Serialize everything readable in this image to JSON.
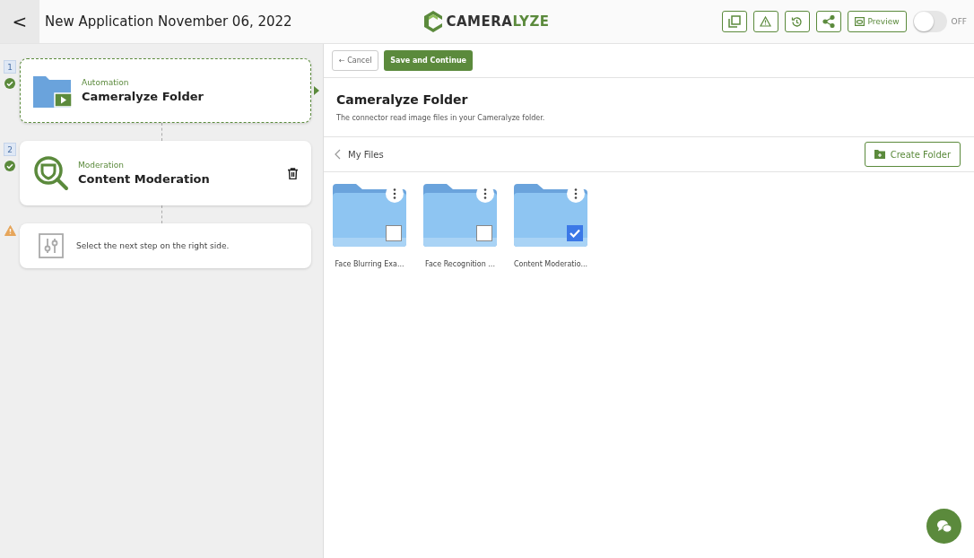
{
  "header": {
    "back": "<",
    "title": "New Application November 06, 2022",
    "logo_text": [
      "CAMERA",
      "LYZE"
    ],
    "tools": [
      {
        "kind": "copy"
      },
      {
        "kind": "warning"
      },
      {
        "kind": "history"
      },
      {
        "kind": "share"
      }
    ],
    "preview": "Preview",
    "toggle": {
      "on": false,
      "label": "OFF"
    }
  },
  "steps": [
    {
      "number": "1",
      "complete": true,
      "kind": "folder",
      "category": "Automation",
      "title": "Cameralyze Folder",
      "selected": true,
      "deletable": false
    },
    {
      "number": "2",
      "complete": true,
      "kind": "moderation",
      "category": "Moderation",
      "title": "Content Moderation",
      "selected": false,
      "deletable": true
    },
    {
      "complete": false,
      "kind": "placeholder",
      "text": "Select the next step on the right side.",
      "selected": false,
      "deletable": false
    }
  ],
  "panel": {
    "cancel": "← Cancel",
    "save": "Save and Continue",
    "title": "Cameralyze Folder",
    "description": "The connector read image files in your Cameralyze folder.",
    "breadcrumb": "My Files",
    "create_folder": "Create Folder",
    "folders": [
      {
        "name": "Face Blurring Exa...",
        "checked": false
      },
      {
        "name": "Face Recognition ...",
        "checked": false
      },
      {
        "name": "Content Moderatio...",
        "checked": true
      }
    ]
  }
}
